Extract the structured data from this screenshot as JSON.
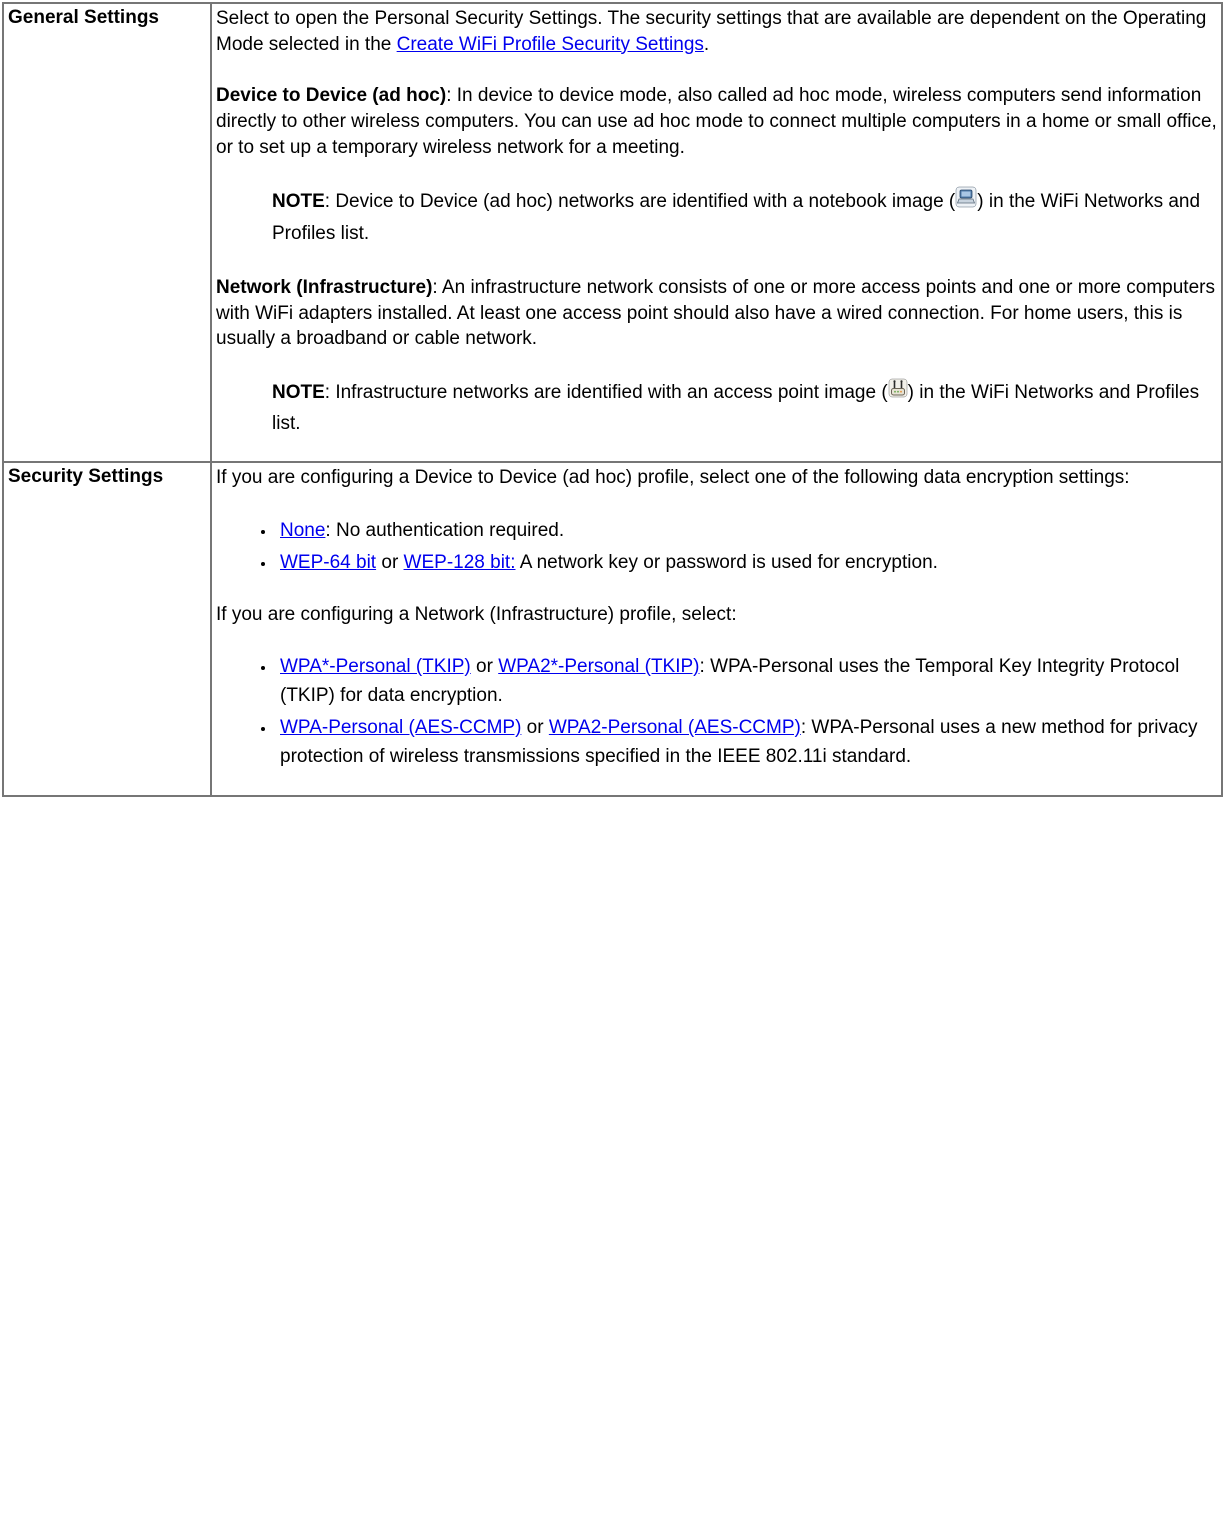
{
  "table": {
    "row_general": {
      "label": "General Settings",
      "intro_before_link": "Select to open the Personal Security Settings. The security settings that are available are dependent on the Operating Mode selected in the ",
      "intro_link": "Create WiFi Profile Security Settings",
      "intro_after_link": ".",
      "adhoc_label": "Device to Device (ad hoc)",
      "adhoc_text": ": In device to device mode, also called ad hoc mode, wireless computers send information directly to other wireless computers. You can use ad hoc mode to connect multiple computers in a home or small office, or to set up a temporary wireless network for a meeting.",
      "adhoc_note_label": "NOTE",
      "adhoc_note_before_icon": ": Device to Device (ad hoc) networks are identified with a notebook image (",
      "adhoc_note_after_icon": ") in the WiFi Networks and Profiles list.",
      "infra_label": "Network (Infrastructure)",
      "infra_text": ": An infrastructure network consists of one or more access points and one or more computers with WiFi adapters installed. At least one access point should also have a wired connection. For home users, this is usually a broadband or cable network.",
      "infra_note_label": "NOTE",
      "infra_note_before_icon": ": Infrastructure networks are identified with an access point image (",
      "infra_note_after_icon": ") in the WiFi Networks and Profiles list."
    },
    "row_security": {
      "label": "Security Settings",
      "adhoc_intro": "If you are configuring a Device to Device (ad hoc) profile, select one of the following data encryption settings:",
      "adhoc_items": {
        "none_link": "None",
        "none_text": ": No authentication required.",
        "wep64_link": "WEP-64 bit",
        "wep_or": " or ",
        "wep128_link": "WEP-128 bit:",
        "wep_text": " A network key or password is used for encryption."
      },
      "infra_intro": "If you are configuring a Network (Infrastructure) profile, select:",
      "infra_items": {
        "wpa_tkip_link": "WPA*-Personal (TKIP)",
        "tkip_or": " or ",
        "wpa2_tkip_link": "WPA2*-Personal (TKIP)",
        "tkip_text": ": WPA-Personal uses the Temporal Key Integrity Protocol (TKIP) for data encryption.",
        "wpa_aes_link": "WPA-Personal (AES-CCMP)",
        "aes_or": " or ",
        "wpa2_aes_link": "WPA2-Personal (AES-CCMP)",
        "aes_text": ": WPA-Personal uses a new method for privacy protection of wireless transmissions specified in the IEEE 802.11i standard."
      }
    }
  }
}
